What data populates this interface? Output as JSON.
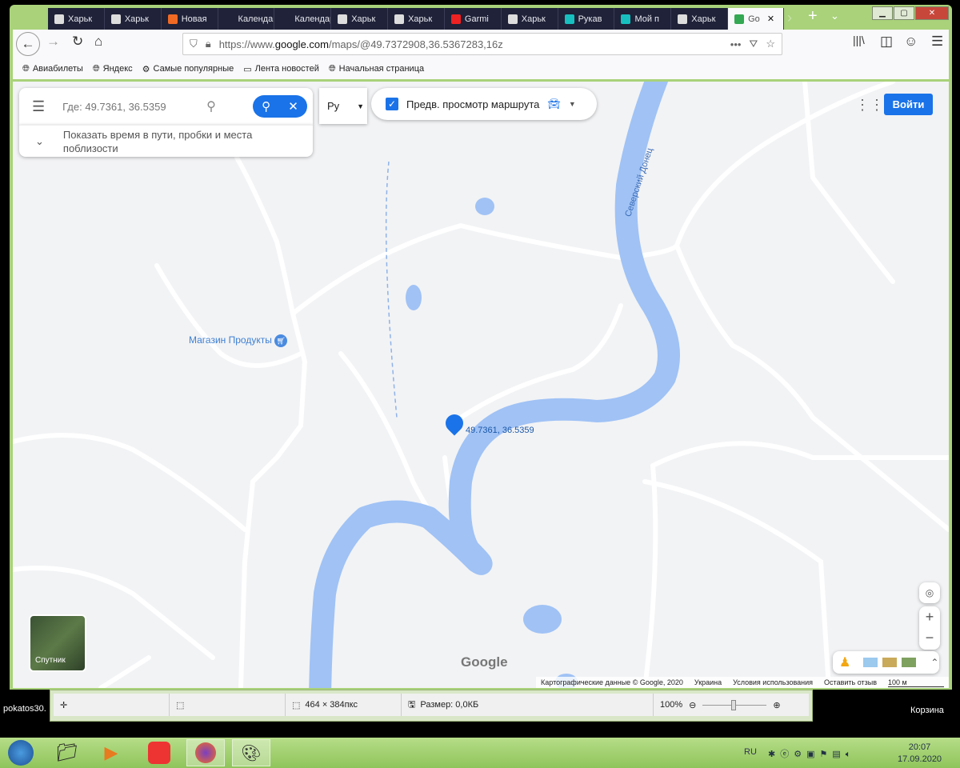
{
  "browser": {
    "tabs": [
      {
        "label": "Харьк",
        "icon": "tower"
      },
      {
        "label": "Харьк",
        "icon": "tower"
      },
      {
        "label": "Новая",
        "icon": "firefox"
      },
      {
        "label": "Календар",
        "icon": ""
      },
      {
        "label": "Календар",
        "icon": ""
      },
      {
        "label": "Харьк",
        "icon": "tower"
      },
      {
        "label": "Харьк",
        "icon": "tower"
      },
      {
        "label": "Garmi",
        "icon": "youtube"
      },
      {
        "label": "Харьк",
        "icon": "tower"
      },
      {
        "label": "Рукав",
        "icon": "ok"
      },
      {
        "label": "Мой п",
        "icon": "ok"
      },
      {
        "label": "Харьк",
        "icon": "tower"
      },
      {
        "label": "Go",
        "icon": "maps",
        "active": true
      }
    ],
    "url_prefix": "https://www.",
    "url_domain": "google.com",
    "url_path": "/maps/@49.7372908,36.5367283,16z",
    "bookmarks": [
      "Авиабилеты",
      "Яндекс",
      "Самые популярные",
      "Лента новостей",
      "Начальная страница"
    ]
  },
  "maps": {
    "search_placeholder": "Где: 49.7361, 36.5359",
    "suggestion": "Показать время в пути, пробки и места поблизости",
    "lang": "Ру",
    "route_preview": "Предв. просмотр маршрута",
    "login": "Войти",
    "place_label": "Магазин Продукты",
    "river_label": "Северский Донец",
    "pin_label": "49.7361, 36.5359",
    "satellite_label": "Спутник",
    "logo": "Google",
    "attribution": [
      "Картографические данные © Google, 2020",
      "Украина",
      "Условия использования",
      "Оставить отзыв",
      "100 м"
    ],
    "colors": {
      "water": "#a0c2f5",
      "accent": "#1a73e8"
    }
  },
  "paint": {
    "size": "464 × 384пкс",
    "file_size": "Размер: 0,0КБ",
    "zoom": "100%"
  },
  "desktop": {
    "icon1": "pokatos30.",
    "icon2": "Корзина"
  },
  "taskbar": {
    "lang": "RU",
    "time": "20:07",
    "date": "17.09.2020"
  }
}
